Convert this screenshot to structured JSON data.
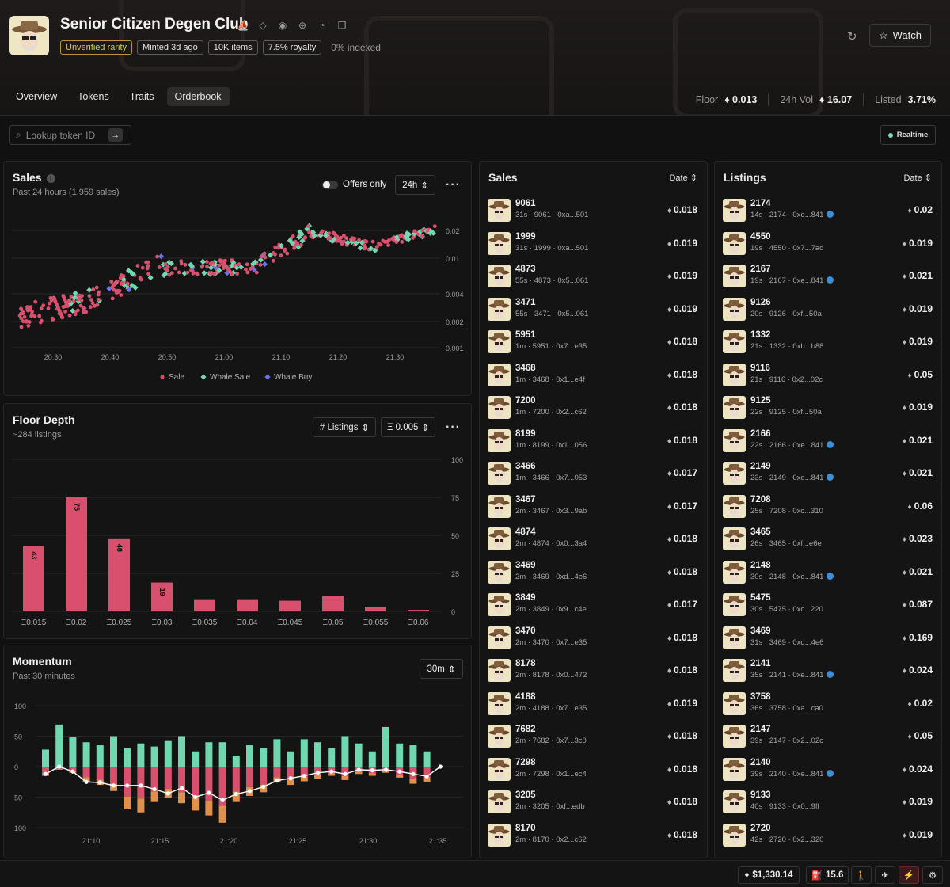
{
  "collection": {
    "title": "Senior Citizen Degen Club",
    "badges": [
      "Unverified rarity",
      "Minted 3d ago",
      "10K items",
      "7.5% royalty"
    ],
    "indexed": "0% indexed",
    "watch_label": "Watch"
  },
  "tabs": [
    "Overview",
    "Tokens",
    "Traits",
    "Orderbook"
  ],
  "stats": {
    "floor_label": "Floor",
    "floor_value": "0.013",
    "vol_label": "24h Vol",
    "vol_value": "16.07",
    "listed_label": "Listed",
    "listed_value": "3.71%"
  },
  "search": {
    "placeholder": "Lookup token ID"
  },
  "realtime_label": "Realtime",
  "sales_chart": {
    "title": "Sales",
    "subtitle": "Past 24 hours (1,959 sales)",
    "toggle_label": "Offers only",
    "range_label": "24h",
    "y_ticks": [
      "0.02",
      "0.01",
      "0.004",
      "0.002",
      "0.001"
    ],
    "x_ticks": [
      "20:30",
      "20:40",
      "20:50",
      "21:00",
      "21:10",
      "21:20",
      "21:30"
    ],
    "legend": [
      "Sale",
      "Whale Sale",
      "Whale Buy"
    ],
    "colors": {
      "sale": "#d9506f",
      "whale_sale": "#6fd8b0",
      "whale_buy": "#6a73e8"
    }
  },
  "floor_depth": {
    "title": "Floor Depth",
    "subtitle": "~284 listings",
    "mode_label": "# Listings",
    "step_label": "Ξ 0.005",
    "y_ticks": [
      "100",
      "75",
      "50",
      "25",
      "0"
    ]
  },
  "momentum": {
    "title": "Momentum",
    "subtitle": "Past 30 minutes",
    "range_label": "30m",
    "y_ticks": [
      "100",
      "50",
      "0",
      "50",
      "100"
    ],
    "x_ticks": [
      "21:10",
      "21:15",
      "21:20",
      "21:25",
      "21:30",
      "21:35"
    ]
  },
  "chart_data": [
    {
      "type": "bar",
      "title": "Floor Depth",
      "categories": [
        "Ξ0.015",
        "Ξ0.02",
        "Ξ0.025",
        "Ξ0.03",
        "Ξ0.035",
        "Ξ0.04",
        "Ξ0.045",
        "Ξ0.05",
        "Ξ0.055",
        "Ξ0.06"
      ],
      "values": [
        43,
        75,
        48,
        19,
        8,
        8,
        7,
        10,
        3,
        1
      ],
      "labeled": [
        true,
        true,
        true,
        true,
        false,
        false,
        false,
        false,
        false,
        false
      ],
      "ylim": [
        0,
        100
      ],
      "color": "#d9506f"
    },
    {
      "type": "bar",
      "title": "Momentum",
      "categories": [
        "21:07",
        "21:08",
        "21:09",
        "21:10",
        "21:11",
        "21:12",
        "21:13",
        "21:14",
        "21:15",
        "21:16",
        "21:17",
        "21:18",
        "21:19",
        "21:20",
        "21:21",
        "21:22",
        "21:23",
        "21:24",
        "21:25",
        "21:26",
        "21:27",
        "21:28",
        "21:29",
        "21:30",
        "21:31",
        "21:32",
        "21:33",
        "21:34",
        "21:35",
        "21:36"
      ],
      "ylim": [
        -100,
        100
      ],
      "series": [
        {
          "values": [
            28,
            69,
            48,
            40,
            35,
            50,
            30,
            38,
            33,
            42,
            50,
            25,
            40,
            40,
            18,
            35,
            30,
            45,
            25,
            45,
            40,
            30,
            50,
            38,
            25,
            65,
            38,
            35,
            25,
            0
          ]
        },
        {
          "values": [
            -15,
            -5,
            -10,
            -25,
            -30,
            -40,
            -70,
            -75,
            -58,
            -52,
            -60,
            -72,
            -80,
            -92,
            -58,
            -48,
            -42,
            -25,
            -30,
            -24,
            -20,
            -15,
            -22,
            -12,
            -15,
            -10,
            -18,
            -28,
            -25,
            0
          ]
        },
        {
          "values": [
            -12,
            0,
            -8,
            -25,
            -26,
            -31,
            -31,
            -31,
            -37,
            -44,
            -35,
            -50,
            -43,
            -55,
            -45,
            -40,
            -33,
            -23,
            -19,
            -15,
            -10,
            -8,
            -12,
            -5,
            -6,
            -5,
            -8,
            -12,
            -16,
            0
          ]
        }
      ]
    }
  ],
  "sales_list": {
    "title": "Sales",
    "sort_label": "Date",
    "rows": [
      {
        "id": "9061",
        "meta": "31s · 9061 · 0xa...501",
        "price": "0.018"
      },
      {
        "id": "1999",
        "meta": "31s · 1999 · 0xa...501",
        "price": "0.019"
      },
      {
        "id": "4873",
        "meta": "55s · 4873 · 0x5...061",
        "price": "0.019"
      },
      {
        "id": "3471",
        "meta": "55s · 3471 · 0x5...061",
        "price": "0.019"
      },
      {
        "id": "5951",
        "meta": "1m · 5951 · 0x7...e35",
        "price": "0.018"
      },
      {
        "id": "3468",
        "meta": "1m · 3468 · 0x1...e4f",
        "price": "0.018"
      },
      {
        "id": "7200",
        "meta": "1m · 7200 · 0x2...c62",
        "price": "0.018"
      },
      {
        "id": "8199",
        "meta": "1m · 8199 · 0x1...056",
        "price": "0.018"
      },
      {
        "id": "3466",
        "meta": "1m · 3466 · 0x7...053",
        "price": "0.017"
      },
      {
        "id": "3467",
        "meta": "2m · 3467 · 0x3...9ab",
        "price": "0.017"
      },
      {
        "id": "4874",
        "meta": "2m · 4874 · 0x0...3a4",
        "price": "0.018"
      },
      {
        "id": "3469",
        "meta": "2m · 3469 · 0xd...4e6",
        "price": "0.018"
      },
      {
        "id": "3849",
        "meta": "2m · 3849 · 0x9...c4e",
        "price": "0.017"
      },
      {
        "id": "3470",
        "meta": "2m · 3470 · 0x7...e35",
        "price": "0.018"
      },
      {
        "id": "8178",
        "meta": "2m · 8178 · 0x0...472",
        "price": "0.018"
      },
      {
        "id": "4188",
        "meta": "2m · 4188 · 0x7...e35",
        "price": "0.019"
      },
      {
        "id": "7682",
        "meta": "2m · 7682 · 0x7...3c0",
        "price": "0.018"
      },
      {
        "id": "7298",
        "meta": "2m · 7298 · 0x1...ec4",
        "price": "0.018"
      },
      {
        "id": "3205",
        "meta": "2m · 3205 · 0xf...edb",
        "price": "0.018"
      },
      {
        "id": "8170",
        "meta": "2m · 8170 · 0x2...c62",
        "price": "0.018"
      }
    ]
  },
  "listings_list": {
    "title": "Listings",
    "sort_label": "Date",
    "rows": [
      {
        "id": "2174",
        "meta": "14s · 2174 · 0xe...841",
        "price": "0.02",
        "badge": true
      },
      {
        "id": "4550",
        "meta": "19s · 4550 · 0x7...7ad",
        "price": "0.019",
        "badge": false
      },
      {
        "id": "2167",
        "meta": "19s · 2167 · 0xe...841",
        "price": "0.021",
        "badge": true
      },
      {
        "id": "9126",
        "meta": "20s · 9126 · 0xf...50a",
        "price": "0.019",
        "badge": false
      },
      {
        "id": "1332",
        "meta": "21s · 1332 · 0xb...b88",
        "price": "0.019",
        "badge": false
      },
      {
        "id": "9116",
        "meta": "21s · 9116 · 0x2...02c",
        "price": "0.05",
        "badge": false
      },
      {
        "id": "9125",
        "meta": "22s · 9125 · 0xf...50a",
        "price": "0.019",
        "badge": false
      },
      {
        "id": "2166",
        "meta": "22s · 2166 · 0xe...841",
        "price": "0.021",
        "badge": true
      },
      {
        "id": "2149",
        "meta": "23s · 2149 · 0xe...841",
        "price": "0.021",
        "badge": true
      },
      {
        "id": "7208",
        "meta": "25s · 7208 · 0xc...310",
        "price": "0.06",
        "badge": false
      },
      {
        "id": "3465",
        "meta": "26s · 3465 · 0xf...e6e",
        "price": "0.023",
        "badge": false
      },
      {
        "id": "2148",
        "meta": "30s · 2148 · 0xe...841",
        "price": "0.021",
        "badge": true
      },
      {
        "id": "5475",
        "meta": "30s · 5475 · 0xc...220",
        "price": "0.087",
        "badge": false
      },
      {
        "id": "3469",
        "meta": "31s · 3469 · 0xd...4e6",
        "price": "0.169",
        "badge": false
      },
      {
        "id": "2141",
        "meta": "35s · 2141 · 0xe...841",
        "price": "0.024",
        "badge": true
      },
      {
        "id": "3758",
        "meta": "36s · 3758 · 0xa...ca0",
        "price": "0.02",
        "badge": false
      },
      {
        "id": "2147",
        "meta": "39s · 2147 · 0x2...02c",
        "price": "0.05",
        "badge": false
      },
      {
        "id": "2140",
        "meta": "39s · 2140 · 0xe...841",
        "price": "0.024",
        "badge": true
      },
      {
        "id": "9133",
        "meta": "40s · 9133 · 0x0...9ff",
        "price": "0.019",
        "badge": false
      },
      {
        "id": "2720",
        "meta": "42s · 2720 · 0x2...320",
        "price": "0.019",
        "badge": false
      }
    ]
  },
  "footer": {
    "eth_price": "$1,330.14",
    "gas": "15.6"
  }
}
